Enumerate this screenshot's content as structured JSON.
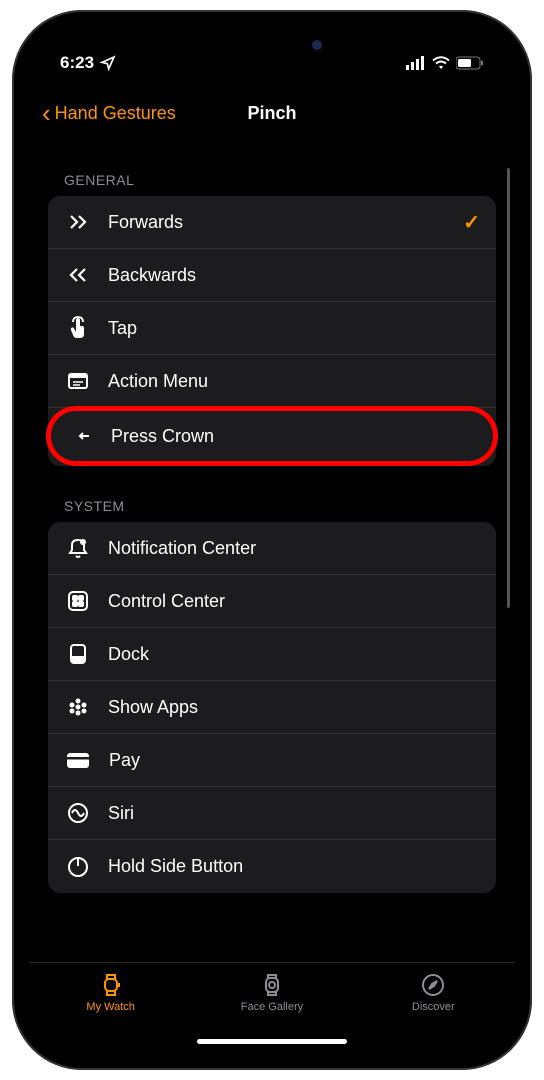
{
  "status": {
    "time": "6:23"
  },
  "nav": {
    "back_label": "Hand Gestures",
    "title": "Pinch"
  },
  "sections": [
    {
      "header": "GENERAL",
      "items": [
        {
          "icon": "forwards-icon",
          "label": "Forwards",
          "checked": true,
          "highlighted": false
        },
        {
          "icon": "backwards-icon",
          "label": "Backwards",
          "checked": false,
          "highlighted": false
        },
        {
          "icon": "tap-icon",
          "label": "Tap",
          "checked": false,
          "highlighted": false
        },
        {
          "icon": "action-menu-icon",
          "label": "Action Menu",
          "checked": false,
          "highlighted": false
        },
        {
          "icon": "press-crown-icon",
          "label": "Press Crown",
          "checked": false,
          "highlighted": true
        }
      ]
    },
    {
      "header": "SYSTEM",
      "items": [
        {
          "icon": "notification-icon",
          "label": "Notification Center",
          "checked": false,
          "highlighted": false
        },
        {
          "icon": "control-center-icon",
          "label": "Control Center",
          "checked": false,
          "highlighted": false
        },
        {
          "icon": "dock-icon",
          "label": "Dock",
          "checked": false,
          "highlighted": false
        },
        {
          "icon": "show-apps-icon",
          "label": "Show Apps",
          "checked": false,
          "highlighted": false
        },
        {
          "icon": "apple-pay-icon",
          "label": "Pay",
          "apple_prefix": true,
          "checked": false,
          "highlighted": false
        },
        {
          "icon": "siri-icon",
          "label": "Siri",
          "checked": false,
          "highlighted": false
        },
        {
          "icon": "hold-side-icon",
          "label": "Hold Side Button",
          "checked": false,
          "highlighted": false
        }
      ]
    }
  ],
  "tabs": [
    {
      "icon": "watch-icon",
      "label": "My Watch",
      "active": true
    },
    {
      "icon": "face-gallery-icon",
      "label": "Face Gallery",
      "active": false
    },
    {
      "icon": "discover-icon",
      "label": "Discover",
      "active": false
    }
  ]
}
